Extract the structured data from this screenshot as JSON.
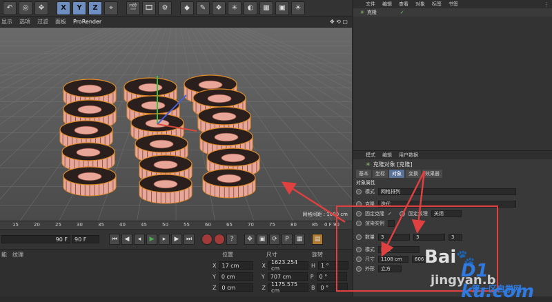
{
  "toolbar": {
    "axes": [
      "X",
      "Y",
      "Z"
    ]
  },
  "viewport_menu": {
    "items": [
      "显示",
      "选项",
      "过滤",
      "面板",
      "ProRender"
    ]
  },
  "viewport": {
    "grid_label": "网格间距 : 1000 cm"
  },
  "right_panel": {
    "object_menu": [
      "文件",
      "编辑",
      "查看",
      "对象",
      "标签",
      "书签"
    ],
    "object_name": "克隆",
    "attr_menu": [
      "模式",
      "编辑",
      "用户数据"
    ],
    "attr_title": "克隆对象 [克隆]",
    "tabs": [
      "基本",
      "坐标",
      "对象",
      "变换",
      "效果器"
    ],
    "active_tab": "对象",
    "section": "对象属性",
    "mode_label": "模式",
    "mode_value": "网格排列",
    "clone_label": "克隆",
    "clone_value": "迭代",
    "fixed_clone": "固定克隆",
    "fixed_texture": "固定纹理",
    "fixed_texture_value": "关闭",
    "render_instances": "渲染实例",
    "count_label": "数量",
    "count_values": [
      "3",
      "3",
      "3"
    ],
    "mode2_label": "模式",
    "mode2_value": "端点",
    "size_label": "尺寸",
    "size_values": [
      "1108 cm",
      "606"
    ],
    "shape_label": "外形",
    "shape_value": "立方"
  },
  "timeline": {
    "ticks": [
      "15",
      "20",
      "25",
      "30",
      "35",
      "40",
      "45",
      "50",
      "55",
      "60",
      "65",
      "70",
      "75",
      "80",
      "85",
      "90"
    ],
    "frame_end_label": "0 F"
  },
  "transport": {
    "start_field": "90 F",
    "end_field": "90 F"
  },
  "coordinates": {
    "left_tabs": [
      "能",
      "纹理"
    ],
    "headers": [
      "位置",
      "尺寸",
      "旋转"
    ],
    "rows": [
      {
        "axis": "X",
        "pos": "17 cm",
        "size": "1623.254 cm",
        "rot_label": "H",
        "rot": "1 °"
      },
      {
        "axis": "Y",
        "pos": "0 cm",
        "size": "707 cm",
        "rot_label": "P",
        "rot": "0 °"
      },
      {
        "axis": "Z",
        "pos": "0 cm",
        "size": "1175.575 cm",
        "rot_label": "B",
        "rot": "0 °"
      }
    ]
  },
  "watermarks": {
    "baidu": "Bai",
    "jingyan": "jingyan.b",
    "site": "D1 ku.com",
    "site_sub": "第一区自学网"
  },
  "colors": {
    "torus": "#e8a698",
    "torus_outline": "#e08a28",
    "annotation_red": "#e04040",
    "active_tab": "#5b7298"
  }
}
